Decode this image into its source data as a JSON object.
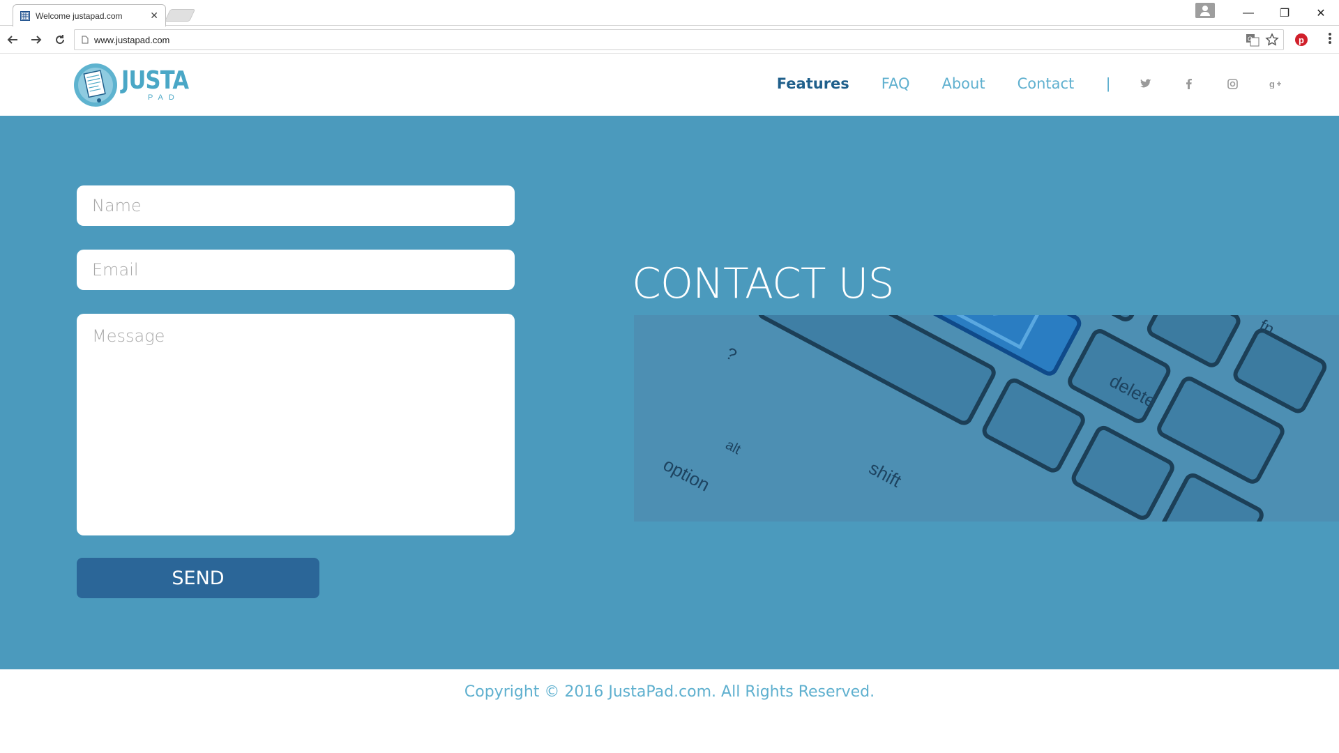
{
  "browser": {
    "tab_title": "Welcome justapad.com",
    "url": "www.justapad.com",
    "close_tab": "✕",
    "minimize": "—",
    "restore": "❐",
    "close_window": "✕"
  },
  "site": {
    "logo_word": "JUSTA",
    "logo_sub": "PAD",
    "nav": [
      {
        "label": "Features",
        "active": true
      },
      {
        "label": "FAQ"
      },
      {
        "label": "About"
      },
      {
        "label": "Contact"
      }
    ],
    "nav_separator": "|",
    "social_icons": [
      "twitter-icon",
      "facebook-icon",
      "instagram-icon",
      "google-plus-icon"
    ]
  },
  "contact": {
    "title": "CONTACT US",
    "name_placeholder": "Name",
    "email_placeholder": "Email",
    "message_placeholder": "Message",
    "send_label": "SEND",
    "keyboard_labels": {
      "question": "?",
      "alt": "alt",
      "option": "option",
      "shift": "shift",
      "delete": "delete",
      "fn": "fn"
    }
  },
  "footer": {
    "copyright": "Copyright © 2016 JustaPad.com. All Rights Reserved."
  },
  "colors": {
    "section_bg": "#4b9abd",
    "nav_link": "#5fb0cf",
    "nav_active": "#1f5f8b",
    "send_button": "#2b6698"
  }
}
